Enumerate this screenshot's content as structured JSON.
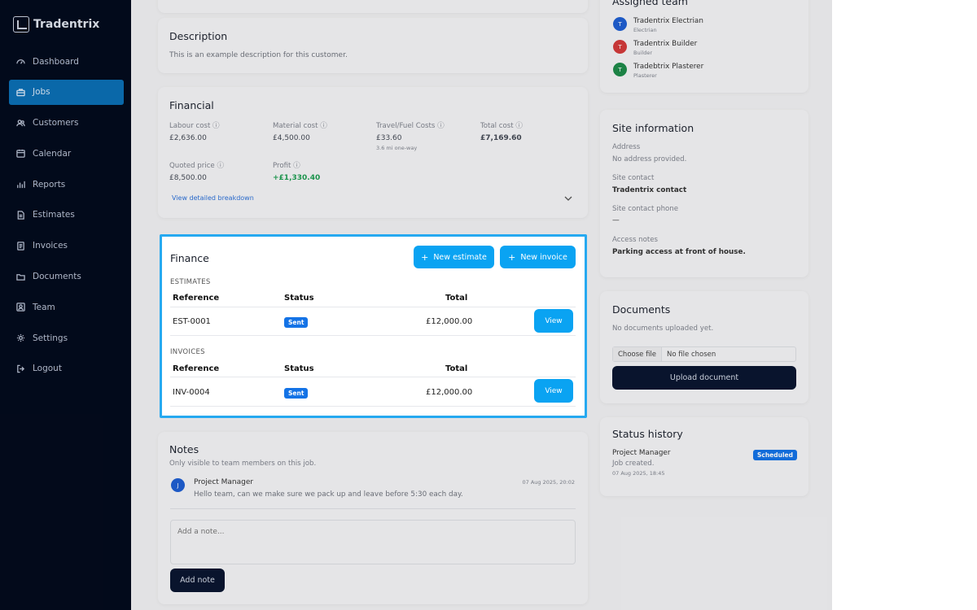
{
  "app": {
    "name": "Tradentrix"
  },
  "sidebar": {
    "items": [
      {
        "label": "Dashboard",
        "icon": "dashboard-icon"
      },
      {
        "label": "Jobs",
        "icon": "briefcase-icon",
        "active": true
      },
      {
        "label": "Customers",
        "icon": "users-icon"
      },
      {
        "label": "Calendar",
        "icon": "calendar-icon"
      },
      {
        "label": "Reports",
        "icon": "bar-chart-icon"
      },
      {
        "label": "Estimates",
        "icon": "file-icon"
      },
      {
        "label": "Invoices",
        "icon": "invoice-icon"
      },
      {
        "label": "Documents",
        "icon": "folder-icon"
      },
      {
        "label": "Team",
        "icon": "team-icon"
      },
      {
        "label": "Settings",
        "icon": "gear-icon"
      },
      {
        "label": "Logout",
        "icon": "logout-icon"
      }
    ]
  },
  "description": {
    "title": "Description",
    "text": "This is an example description for this customer."
  },
  "financial": {
    "title": "Financial",
    "labour_label": "Labour cost",
    "labour_value": "£2,636.00",
    "material_label": "Material cost",
    "material_value": "£4,500.00",
    "travel_label": "Travel/Fuel Costs",
    "travel_value": "£33.60",
    "travel_sub": "3.6 mi one-way",
    "total_label": "Total cost",
    "total_value": "£7,169.60",
    "quoted_label": "Quoted price",
    "quoted_value": "£8,500.00",
    "profit_label": "Profit",
    "profit_value": "+£1,330.40",
    "breakdown_link": "View detailed breakdown"
  },
  "finance": {
    "title": "Finance",
    "new_estimate": "New estimate",
    "new_invoice": "New invoice",
    "estimates_heading": "ESTIMATES",
    "invoices_heading": "INVOICES",
    "col_reference": "Reference",
    "col_status": "Status",
    "col_total": "Total",
    "estimate_row": {
      "reference": "EST-0001",
      "status": "Sent",
      "total": "£12,000.00",
      "action": "View"
    },
    "invoice_row": {
      "reference": "INV-0004",
      "status": "Sent",
      "total": "£12,000.00",
      "action": "View"
    }
  },
  "notes": {
    "title": "Notes",
    "subtitle": "Only visible to team members on this job.",
    "note_author": "Project Manager",
    "note_avatar": "J",
    "note_date": "07 Aug 2025, 20:02",
    "note_text": "Hello team, can we make sure we pack up and leave before 5:30 each day.",
    "placeholder": "Add a note...",
    "add_button": "Add note"
  },
  "team": {
    "title": "Assigned team",
    "members": [
      {
        "name": "Tradentrix Electrian",
        "role": "Electrian",
        "initial": "T",
        "color": "#1f5fd1"
      },
      {
        "name": "Tradentrix Builder",
        "role": "Builder",
        "initial": "T",
        "color": "#d23b3b"
      },
      {
        "name": "Tradebtrix Plasterer",
        "role": "Plasterer",
        "initial": "T",
        "color": "#1e8a4a"
      }
    ]
  },
  "site": {
    "title": "Site information",
    "address_label": "Address",
    "address_value": "No address provided.",
    "contact_label": "Site contact",
    "contact_value": "Tradentrix contact",
    "phone_label": "Site contact phone",
    "phone_value": "—",
    "access_label": "Access notes",
    "access_value": "Parking access at front of house."
  },
  "documents": {
    "title": "Documents",
    "empty": "No documents uploaded yet.",
    "choose_file": "Choose file",
    "no_file": "No file chosen",
    "upload": "Upload document"
  },
  "history": {
    "title": "Status history",
    "author": "Project Manager",
    "event": "Job created.",
    "date": "07 Aug 2025, 18:45",
    "badge": "Scheduled"
  }
}
